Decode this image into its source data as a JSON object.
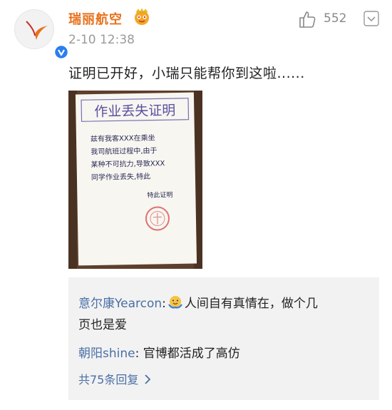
{
  "account": {
    "name": "瑞丽航空",
    "timestamp": "2-10 12:38",
    "accent": "#e8711c",
    "verified_color": "#2a7ef0"
  },
  "actions": {
    "like_count": "552"
  },
  "post": {
    "text": "证明已开好，小瑞只能帮你到这啦......"
  },
  "photo": {
    "title": "作业丢失证明",
    "lines": [
      "兹有我客XXX在乘坐",
      "我司航班过程中,由于",
      "某种不可抗力,导致XXX",
      "同学作业丢失,特此"
    ],
    "sign": "特此证明"
  },
  "comments": [
    {
      "author": "意尔康Yearcon",
      "colon": ":",
      "text_a": "人间自有真情在，做个几",
      "text_b": "页也是爱"
    },
    {
      "author": "朝阳shine",
      "colon": ":",
      "text_a": "官博都活成了高仿"
    }
  ],
  "replies": {
    "label": "共75条回复"
  }
}
